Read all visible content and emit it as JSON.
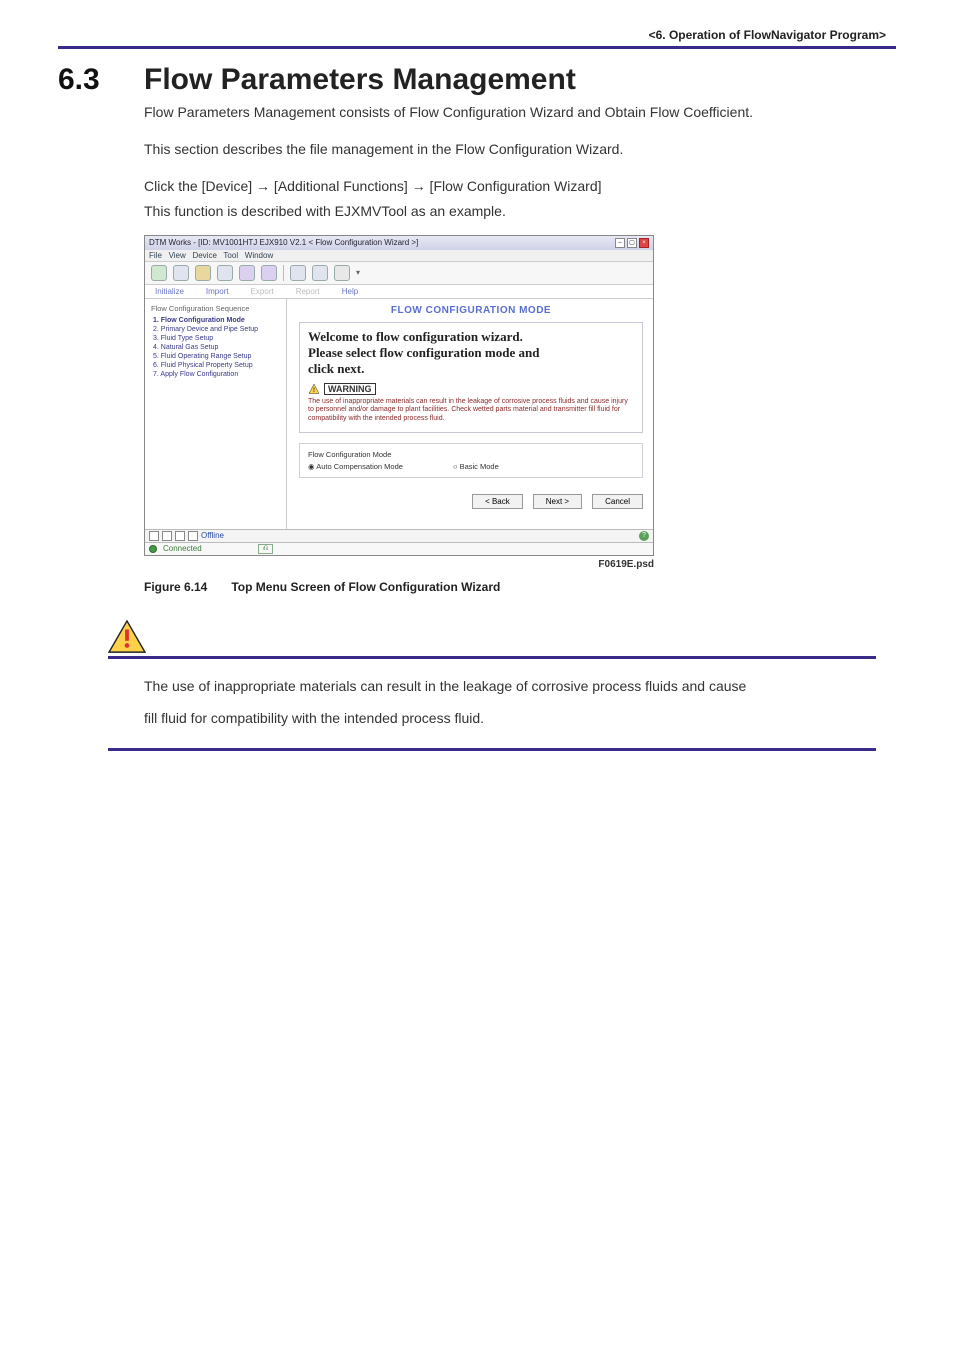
{
  "header": {
    "text": "<6. Operation of FlowNavigator Program>"
  },
  "section": {
    "number": "6.3",
    "title": "Flow Parameters Management"
  },
  "body": {
    "p1": "Flow Parameters Management consists of Flow Configuration Wizard and Obtain Flow Coefficient.",
    "p2": "This section describes the file management in the Flow Configuration Wizard.",
    "p3": "Click the [Device] → [Additional Functions] → [Flow Configuration Wizard]",
    "p4": "This function is described with EJXMVTool as an example."
  },
  "screenshot": {
    "window_title": "DTM Works - [ID: MV1001HTJ EJX910 V2.1 < Flow Configuration Wizard >]",
    "menu": [
      "File",
      "View",
      "Device",
      "Tool",
      "Window"
    ],
    "tabs": [
      "Initialize",
      "Import",
      "Export",
      "Report",
      "Help"
    ],
    "sidebar": {
      "group": "Flow Configuration Sequence",
      "steps": [
        "1. Flow Configuration Mode",
        "2. Primary Device and Pipe Setup",
        "3. Fluid Type Setup",
        "4. Natural Gas Setup",
        "5. Fluid Operating Range Setup",
        "6. Fluid Physical Property Setup",
        "7. Apply Flow Configuration"
      ]
    },
    "main": {
      "title": "FLOW CONFIGURATION MODE",
      "welcome1": "Welcome to flow configuration wizard.",
      "welcome2": "Please select flow configuration mode and",
      "welcome3": "click next.",
      "warning_label": "WARNING",
      "warning_text": "The use of inappropriate materials can result in the leakage of corrosive process fluids and cause injury to personnel and/or damage to plant facilities. Check wetted parts material and transmitter fill fluid for compatibility with the intended process fluid.",
      "mode_group": "Flow Configuration Mode",
      "mode_auto": "Auto Compensation Mode",
      "mode_basic": "Basic Mode",
      "btn_back": "< Back",
      "btn_next": "Next >",
      "btn_cancel": "Cancel"
    },
    "status": {
      "offline": "Offline",
      "connected": "Connected",
      "indicator": "⎌"
    },
    "psd": "F0619E.psd"
  },
  "figure": {
    "number": "Figure 6.14",
    "title": "Top Menu Screen of Flow Configuration Wizard"
  },
  "warning": {
    "p1": "The use of inappropriate materials can result in the leakage of corrosive process fluids and cause",
    "p2": "fill fluid for compatibility with the intended process fluid."
  }
}
